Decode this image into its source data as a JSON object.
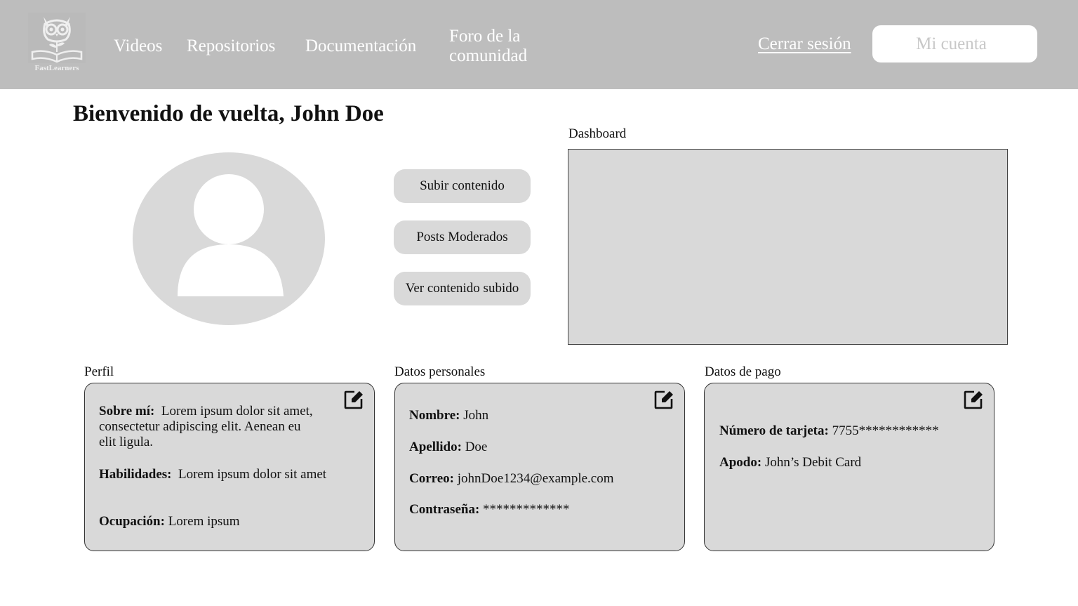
{
  "navbar": {
    "logo_text": "FastLearners",
    "links": [
      "Videos",
      "Repositorios",
      "Documentación",
      "Foro de la comunidad"
    ],
    "logout_label": "Cerrar sesión",
    "account_label": "Mi cuenta"
  },
  "welcome": "Bienvenido de vuelta, John Doe",
  "actions": {
    "upload": "Subir contenido",
    "moderated": "Posts Moderados",
    "view_uploaded": "Ver contenido subido"
  },
  "dashboard": {
    "label": "Dashboard"
  },
  "profile": {
    "label": "Perfil",
    "about_label": "Sobre mí:",
    "about_value": "Lorem ipsum dolor sit amet, consectetur adipiscing elit. Aenean eu elit  ligula.",
    "skills_label": "Habilidades:",
    "skills_value": "Lorem ipsum dolor sit amet",
    "occupation_label": "Ocupación:",
    "occupation_value": "Lorem ipsum"
  },
  "personal": {
    "label": "Datos personales",
    "name_label": "Nombre:",
    "name_value": "John",
    "lastname_label": "Apellido:",
    "lastname_value": "Doe",
    "email_label": "Correo:",
    "email_value": "johnDoe1234@example.com",
    "password_label": "Contraseña:",
    "password_value": "*************"
  },
  "payment": {
    "label": "Datos de pago",
    "card_label": "Número de tarjeta:",
    "card_value": "7755************",
    "alias_label": "Apodo:",
    "alias_value": "John’s Debit Card"
  },
  "icons": {
    "logo": "owl-book-logo",
    "avatar": "user-avatar-icon",
    "edit": "edit-icon"
  },
  "colors": {
    "navbar_bg": "#bdbdbd",
    "panel_bg": "#d9d9d9",
    "text": "#111111",
    "white": "#ffffff"
  }
}
